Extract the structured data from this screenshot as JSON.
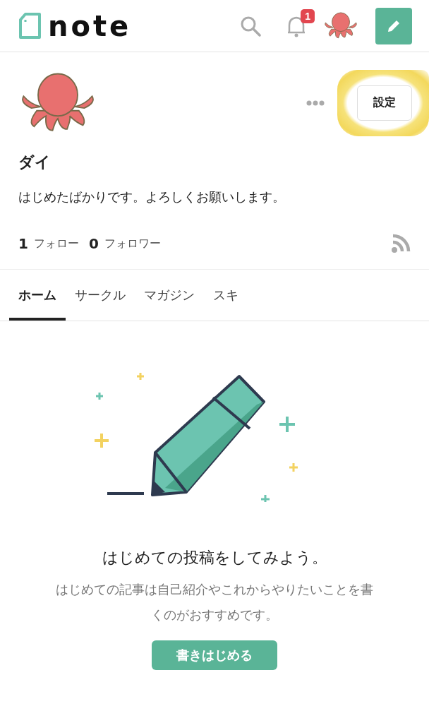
{
  "header": {
    "logo": "note",
    "notification_count": "1"
  },
  "profile": {
    "settings_button": "設定",
    "name": "ダイ",
    "bio": "はじめたばかりです。よろしくお願いします。",
    "follow_count": "1",
    "follow_label": "フォロー",
    "follower_count": "0",
    "follower_label": "フォロワー"
  },
  "tabs": [
    {
      "label": "ホーム",
      "selected": true
    },
    {
      "label": "サークル",
      "selected": false
    },
    {
      "label": "マガジン",
      "selected": false
    },
    {
      "label": "スキ",
      "selected": false
    }
  ],
  "empty_state": {
    "title": "はじめての投稿をしてみよう。",
    "description": "はじめての記事は自己紹介やこれからやりたいことを書くのがおすすめです。",
    "button": "書きはじめる"
  }
}
